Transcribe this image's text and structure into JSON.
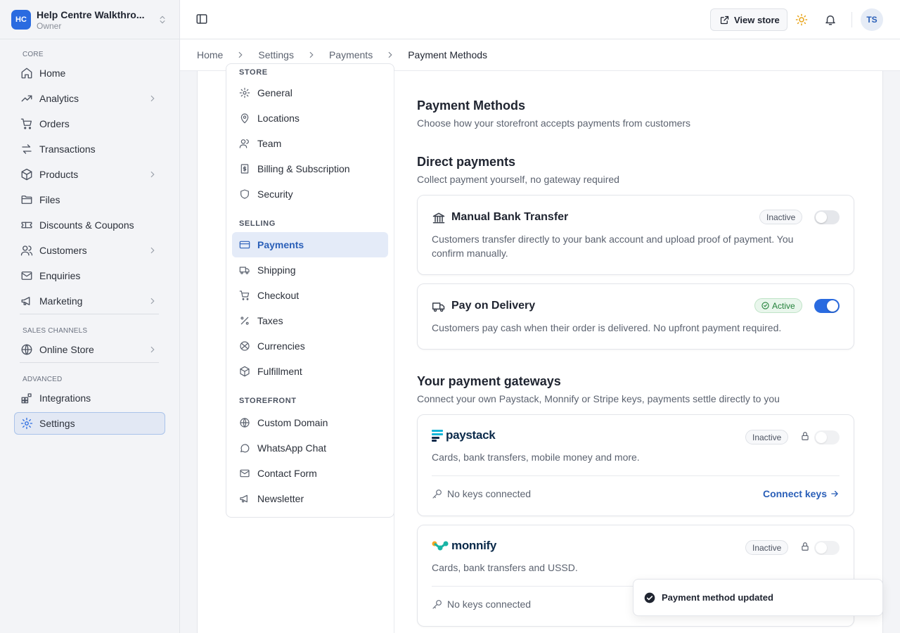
{
  "workspace": {
    "initials": "HC",
    "name": "Help Centre Walkthro...",
    "role": "Owner"
  },
  "sidebar": {
    "groups": {
      "core": "CORE",
      "sales_channels": "SALES CHANNELS",
      "advanced": "ADVANCED"
    },
    "items": [
      {
        "label": "Home",
        "icon": "home-icon"
      },
      {
        "label": "Analytics",
        "icon": "trend-icon"
      },
      {
        "label": "Orders",
        "icon": "cart-icon"
      },
      {
        "label": "Transactions",
        "icon": "arrows-icon"
      },
      {
        "label": "Products",
        "icon": "box-icon"
      },
      {
        "label": "Files",
        "icon": "folder-icon"
      },
      {
        "label": "Discounts & Coupons",
        "icon": "ticket-icon"
      },
      {
        "label": "Customers",
        "icon": "users-icon"
      },
      {
        "label": "Enquiries",
        "icon": "mail-icon"
      },
      {
        "label": "Marketing",
        "icon": "megaphone-icon"
      },
      {
        "label": "Online Store",
        "icon": "globe-icon"
      },
      {
        "label": "Integrations",
        "icon": "grid-plus-icon"
      },
      {
        "label": "Settings",
        "icon": "gear-icon"
      }
    ]
  },
  "topbar": {
    "view_store": "View store",
    "avatar": "TS"
  },
  "breadcrumb": [
    "Home",
    "Settings",
    "Payments",
    "Payment Methods"
  ],
  "subnav": {
    "groups": {
      "store": "STORE",
      "selling": "SELLING",
      "storefront": "STOREFRONT"
    },
    "items": [
      {
        "label": "General"
      },
      {
        "label": "Locations"
      },
      {
        "label": "Team"
      },
      {
        "label": "Billing & Subscription"
      },
      {
        "label": "Security"
      },
      {
        "label": "Payments"
      },
      {
        "label": "Shipping"
      },
      {
        "label": "Checkout"
      },
      {
        "label": "Taxes"
      },
      {
        "label": "Currencies"
      },
      {
        "label": "Fulfillment"
      },
      {
        "label": "Custom Domain"
      },
      {
        "label": "WhatsApp Chat"
      },
      {
        "label": "Contact Form"
      },
      {
        "label": "Newsletter"
      }
    ]
  },
  "page": {
    "title": "Payment Methods",
    "subtitle": "Choose how your storefront accepts payments from customers",
    "direct": {
      "title": "Direct payments",
      "subtitle": "Collect payment yourself, no gateway required",
      "methods": [
        {
          "name": "Manual Bank Transfer",
          "status": "Inactive",
          "enabled": false,
          "description": "Customers transfer directly to your bank account and upload proof of payment. You confirm manually."
        },
        {
          "name": "Pay on Delivery",
          "status": "Active",
          "enabled": true,
          "description": "Customers pay cash when their order is delivered. No upfront payment required."
        }
      ]
    },
    "gateways": {
      "title": "Your payment gateways",
      "subtitle": "Connect your own Paystack, Monnify or Stripe keys, payments settle directly to you",
      "items": [
        {
          "brand": "paystack",
          "status": "Inactive",
          "description": "Cards, bank transfers, mobile money and more.",
          "keys": "No keys connected",
          "action": "Connect keys"
        },
        {
          "brand": "monnify",
          "status": "Inactive",
          "description": "Cards, bank transfers and USSD.",
          "keys": "No keys connected"
        }
      ]
    }
  },
  "toast": {
    "message": "Payment method updated"
  },
  "colors": {
    "accent": "#2a6be0",
    "active_green": "#23813a",
    "sun": "#e8a317"
  }
}
